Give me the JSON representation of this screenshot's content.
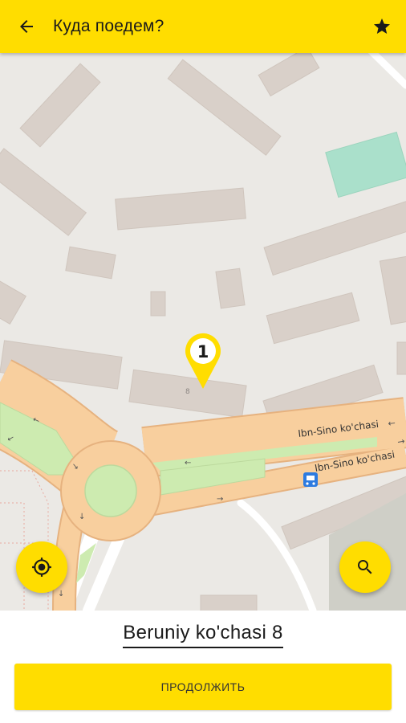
{
  "appbar": {
    "title": "Куда поедем?"
  },
  "map": {
    "pin_number": "1",
    "house_number": "8",
    "street_label_1": "Ibn-Sino ko'chasi",
    "street_label_2": "Ibn-Sino ko'chasi"
  },
  "bottom": {
    "address": "Beruniy ko'chasi 8",
    "continue_label": "ПРОДОЛЖИТЬ"
  },
  "colors": {
    "accent": "#ffdd00",
    "map_background": "#ebe9e5",
    "building": "#d9d0c9",
    "road": "#f8cf9e",
    "green": "#cdebb0",
    "pitch": "#aae0cb"
  }
}
